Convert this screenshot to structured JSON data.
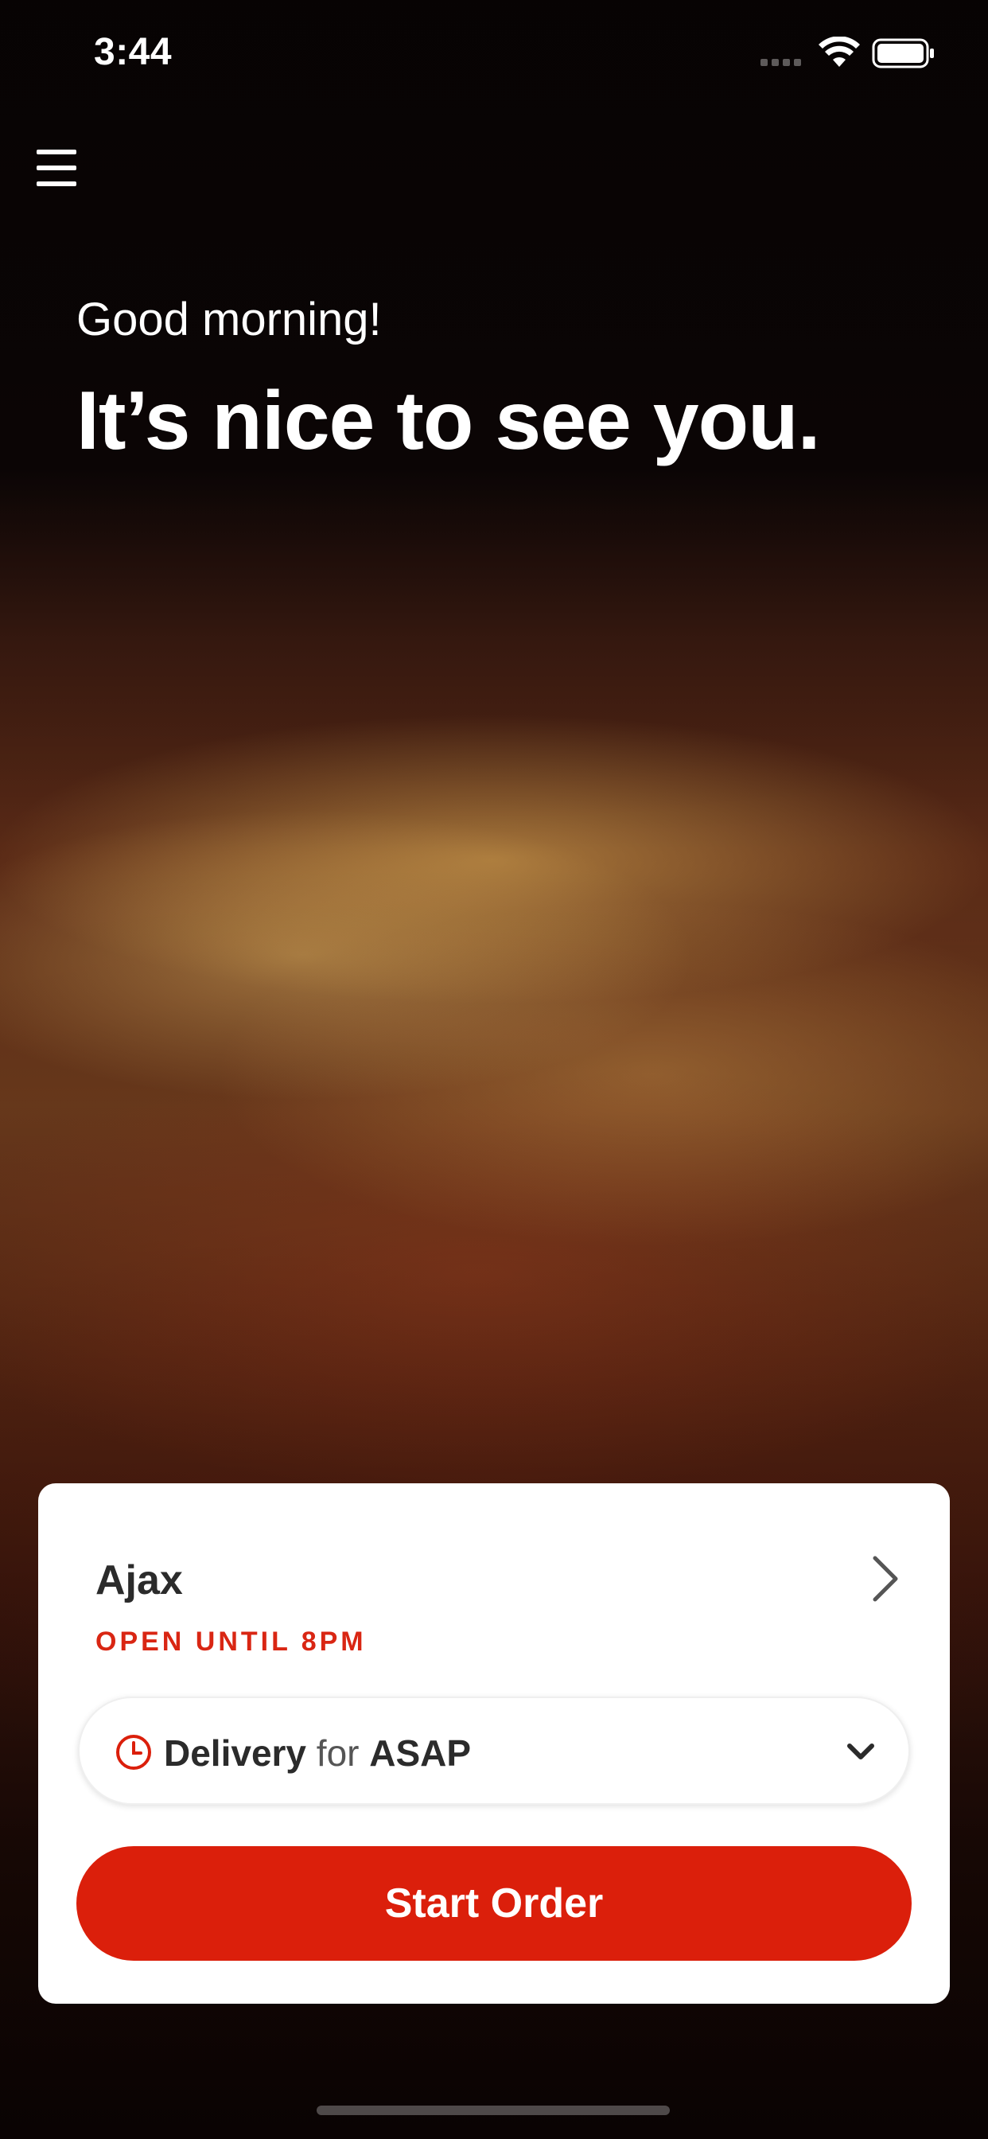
{
  "status_bar": {
    "time": "3:44",
    "icons": [
      "signal-icon",
      "wifi-icon",
      "battery-icon"
    ]
  },
  "header": {
    "menu_icon": "hamburger-menu-icon"
  },
  "hero": {
    "greeting": "Good morning!",
    "headline": "It’s nice to see you."
  },
  "store_card": {
    "store_name": "Ajax",
    "hours": "OPEN UNTIL 8PM",
    "order_mode": {
      "mode": "Delivery",
      "connector": "for",
      "time": "ASAP",
      "icon": "clock-icon"
    },
    "start_button_label": "Start Order"
  },
  "colors": {
    "accent": "#db1f0b",
    "card_background": "#ffffff",
    "text_dark": "#2b2b2b"
  }
}
